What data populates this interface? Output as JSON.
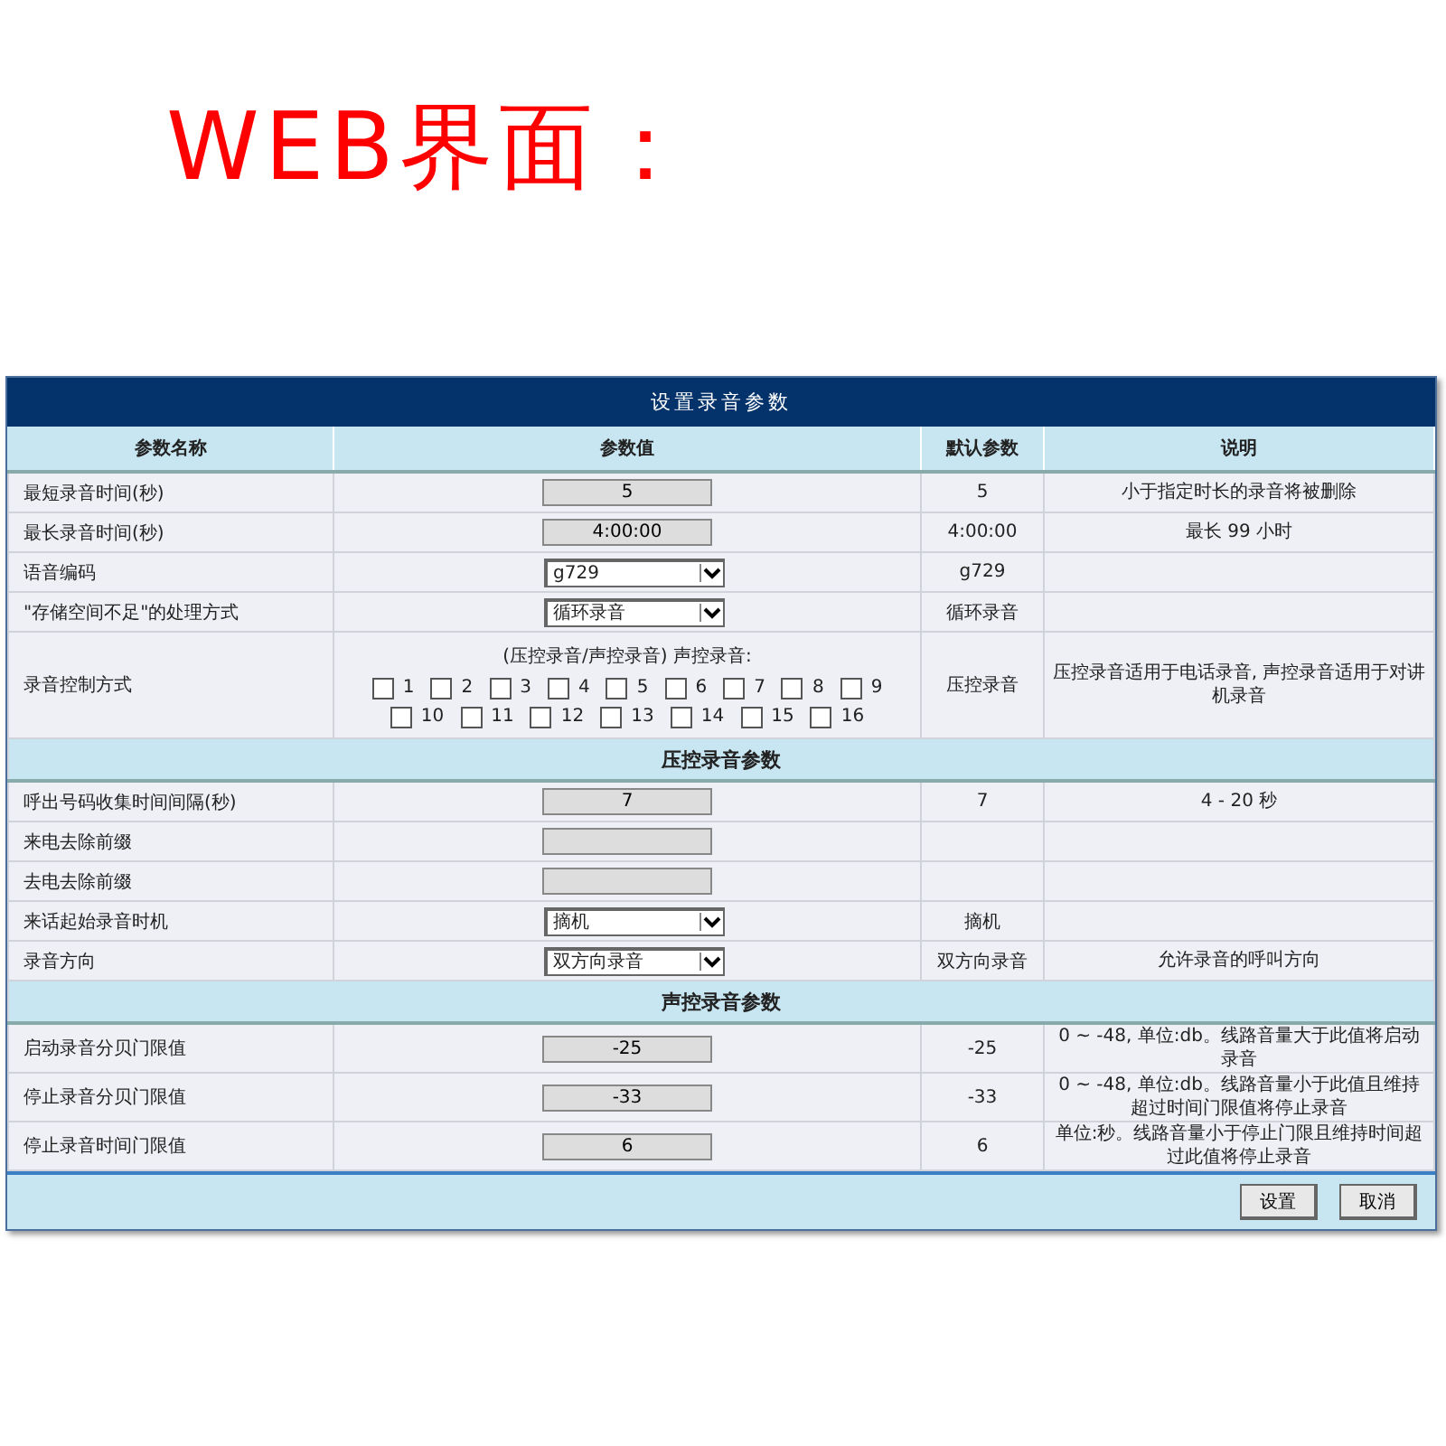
{
  "heading": "WEB界面：",
  "panel": {
    "title": "设置录音参数",
    "columns": [
      "参数名称",
      "参数值",
      "默认参数",
      "说明"
    ],
    "rows": [
      {
        "kind": "input",
        "name": "最短录音时间(秒)",
        "value": "5",
        "default": "5",
        "note": "小于指定时长的录音将被删除"
      },
      {
        "kind": "input",
        "name": "最长录音时间(秒)",
        "value": "4:00:00",
        "default": "4:00:00",
        "note": "最长 99 小时"
      },
      {
        "kind": "select",
        "name": "语音编码",
        "value": "g729",
        "default": "g729"
      },
      {
        "kind": "select",
        "name": "\"存储空间不足\"的处理方式",
        "value": "循环录音",
        "default": "循环录音"
      },
      {
        "kind": "checkboxes",
        "name": "录音控制方式",
        "caption": "(压控录音/声控录音) 声控录音:",
        "options": [
          {
            "label": "1",
            "checked": false
          },
          {
            "label": "2",
            "checked": false
          },
          {
            "label": "3",
            "checked": false
          },
          {
            "label": "4",
            "checked": false
          },
          {
            "label": "5",
            "checked": false
          },
          {
            "label": "6",
            "checked": false
          },
          {
            "label": "7",
            "checked": false
          },
          {
            "label": "8",
            "checked": false
          },
          {
            "label": "9",
            "checked": false
          },
          {
            "label": "10",
            "checked": false
          },
          {
            "label": "11",
            "checked": false
          },
          {
            "label": "12",
            "checked": false
          },
          {
            "label": "13",
            "checked": false
          },
          {
            "label": "14",
            "checked": false
          },
          {
            "label": "15",
            "checked": false
          },
          {
            "label": "16",
            "checked": false
          }
        ],
        "default": "压控录音",
        "note": "压控录音适用于电话录音, 声控录音适用于对讲机录音"
      },
      {
        "kind": "section",
        "name": "压控录音参数"
      },
      {
        "kind": "input",
        "name": "呼出号码收集时间间隔(秒)",
        "value": "7",
        "default": "7",
        "note": "4 - 20 秒"
      },
      {
        "kind": "input",
        "name": "来电去除前缀"
      },
      {
        "kind": "input",
        "name": "去电去除前缀"
      },
      {
        "kind": "select",
        "name": "来话起始录音时机",
        "value": "摘机",
        "default": "摘机"
      },
      {
        "kind": "select",
        "name": "录音方向",
        "value": "双方向录音",
        "default": "双方向录音",
        "note": "允许录音的呼叫方向"
      },
      {
        "kind": "section",
        "name": "声控录音参数"
      },
      {
        "kind": "input",
        "name": "启动录音分贝门限值",
        "value": "-25",
        "default": "-25",
        "note": "0 ~ -48, 单位:db。线路音量大于此值将启动录音"
      },
      {
        "kind": "input",
        "name": "停止录音分贝门限值",
        "value": "-33",
        "default": "-33",
        "note": "0 ~ -48, 单位:db。线路音量小于此值且维持超过时间门限值将停止录音"
      },
      {
        "kind": "input",
        "name": "停止录音时间门限值",
        "value": "6",
        "default": "6",
        "note": "单位:秒。线路音量小于停止门限且维持时间超过此值将停止录音"
      }
    ],
    "buttons": [
      "设置",
      "取消"
    ]
  }
}
